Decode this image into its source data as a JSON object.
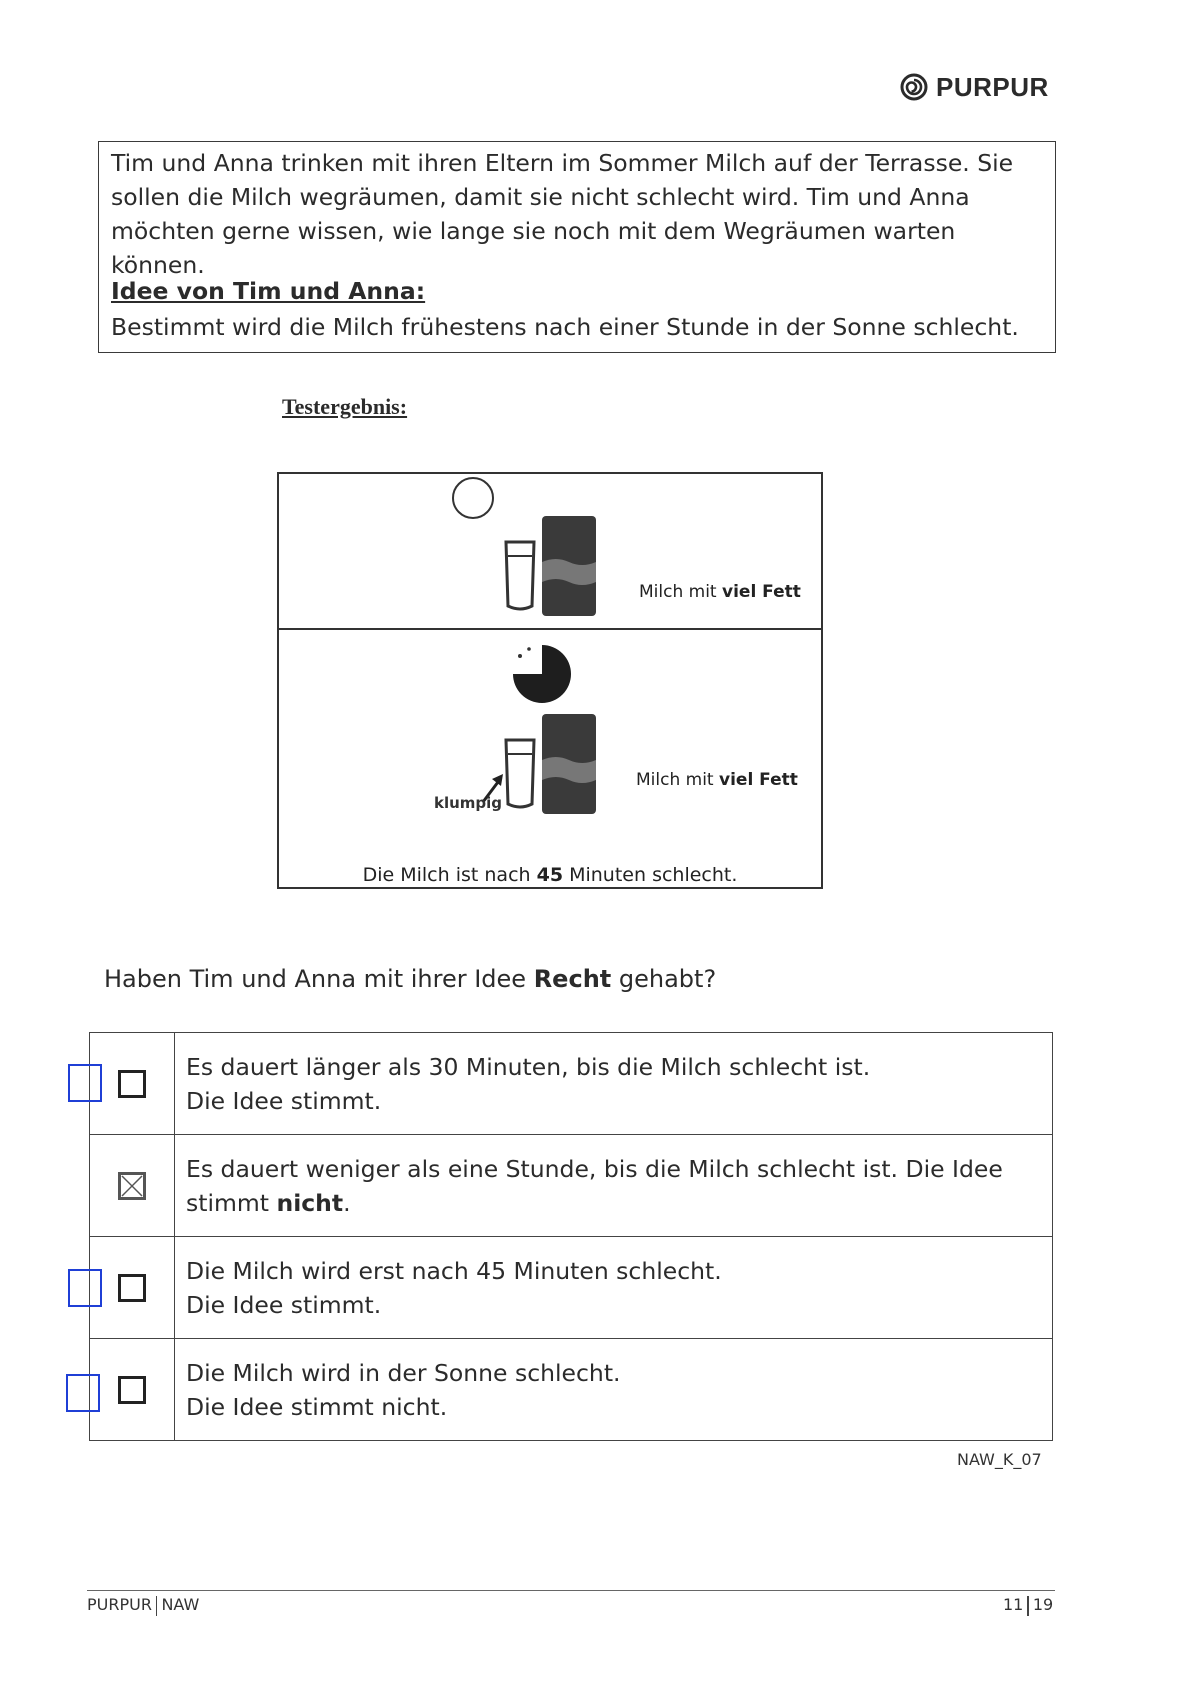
{
  "header": {
    "logo_text": "PURPUR"
  },
  "intro": {
    "text": "Tim und Anna trinken mit ihren Eltern im Sommer Milch auf der Terrasse. Sie sollen die Milch wegräumen, damit sie nicht schlecht wird. Tim und Anna möchten gerne wissen, wie lange sie noch mit dem Wegräumen warten können.",
    "idea_heading": "Idee von Tim und Anna:",
    "idea_text": "Bestimmt wird die Milch frühestens nach einer Stunde in der Sonne schlecht."
  },
  "test": {
    "heading": "Testergebnis:",
    "top_label_pre": "Milch mit ",
    "top_label_bold": "viel Fett",
    "bottom_label_pre": "Milch mit ",
    "bottom_label_bold": "viel Fett",
    "klumpig": "klumpig",
    "caption_pre": "Die Milch ist nach ",
    "caption_bold": "45",
    "caption_post": " Minuten schlecht."
  },
  "question": {
    "pre": "Haben Tim und Anna mit ihrer Idee ",
    "bold": "Recht",
    "post": " gehabt?"
  },
  "answers": [
    {
      "line1": "Es dauert länger als 30 Minuten, bis die Milch schlecht ist.",
      "line2": "Die Idee stimmt.",
      "checked": false
    },
    {
      "line1": "Es dauert weniger als eine Stunde, bis die Milch schlecht ist. Die Idee",
      "line2_pre": "stimmt ",
      "line2_bold": "nicht",
      "line2_post": ".",
      "checked": true
    },
    {
      "line1": "Die Milch wird erst nach 45 Minuten schlecht.",
      "line2": "Die Idee stimmt.",
      "checked": false
    },
    {
      "line1": "Die Milch wird in der Sonne schlecht.",
      "line2": "Die Idee stimmt nicht.",
      "checked": false
    }
  ],
  "doc_code": "NAW_K_07",
  "footer": {
    "left_a": "PURPUR",
    "left_b": "NAW",
    "page_current": "11",
    "page_total": "19"
  },
  "colors": {
    "marker_blue": "#1f3fd6",
    "text": "#2b2b2b"
  }
}
